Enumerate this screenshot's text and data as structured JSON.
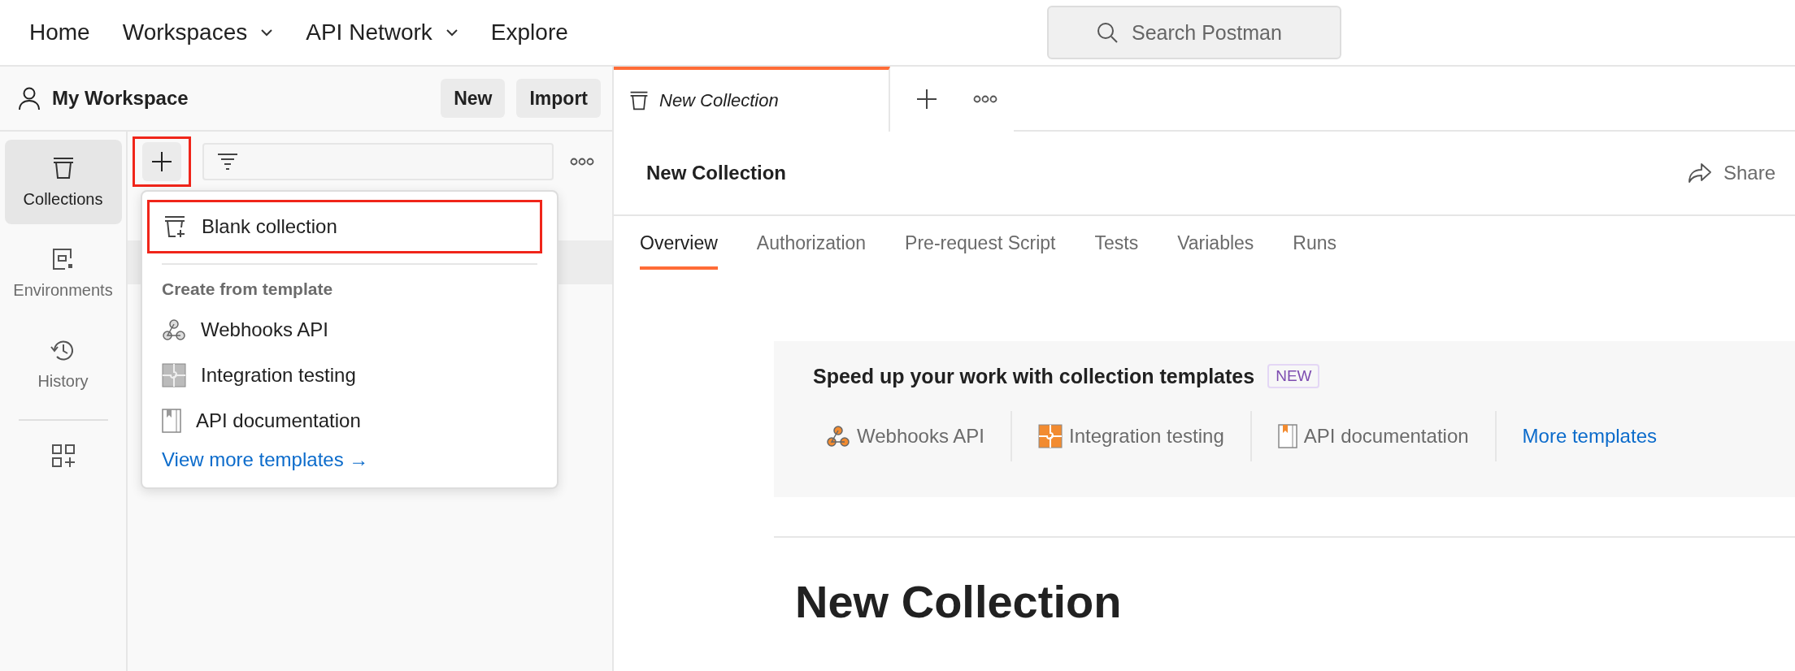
{
  "top_nav": {
    "items": [
      {
        "label": "Home",
        "dropdown": false
      },
      {
        "label": "Workspaces",
        "dropdown": true
      },
      {
        "label": "API Network",
        "dropdown": true
      },
      {
        "label": "Explore",
        "dropdown": false
      }
    ],
    "search": {
      "placeholder": "Search Postman"
    }
  },
  "sidebar": {
    "workspace": "My Workspace",
    "buttons": [
      "New",
      "Import"
    ],
    "nav": [
      {
        "label": "Collections",
        "selected": true
      },
      {
        "label": "Environments",
        "selected": false
      },
      {
        "label": "History",
        "selected": false
      }
    ],
    "plus_highlighted": true
  },
  "add_menu": {
    "items": [
      {
        "kind": "action",
        "label": "Blank collection",
        "highlighted": true
      },
      {
        "kind": "heading",
        "label": "Create from template"
      },
      {
        "kind": "template",
        "label": "Webhooks API"
      },
      {
        "kind": "template",
        "label": "Integration testing"
      },
      {
        "kind": "template",
        "label": "API documentation"
      },
      {
        "kind": "link",
        "label": "View more templates →"
      }
    ]
  },
  "editor": {
    "open_tabs": [
      {
        "label": "New Collection",
        "selected": true
      }
    ],
    "title": "New Collection",
    "share": "Share",
    "tabs": [
      {
        "label": "Overview",
        "selected": true
      },
      {
        "label": "Authorization",
        "selected": false
      },
      {
        "label": "Pre-request Script",
        "selected": false
      },
      {
        "label": "Tests",
        "selected": false
      },
      {
        "label": "Variables",
        "selected": false
      },
      {
        "label": "Runs",
        "selected": false
      }
    ],
    "templates": {
      "heading": "Speed up your work with collection templates",
      "badge": "NEW",
      "items": [
        {
          "label": "Webhooks API"
        },
        {
          "label": "Integration testing"
        },
        {
          "label": "API documentation"
        }
      ],
      "more": "More templates"
    },
    "name": "New Collection"
  }
}
